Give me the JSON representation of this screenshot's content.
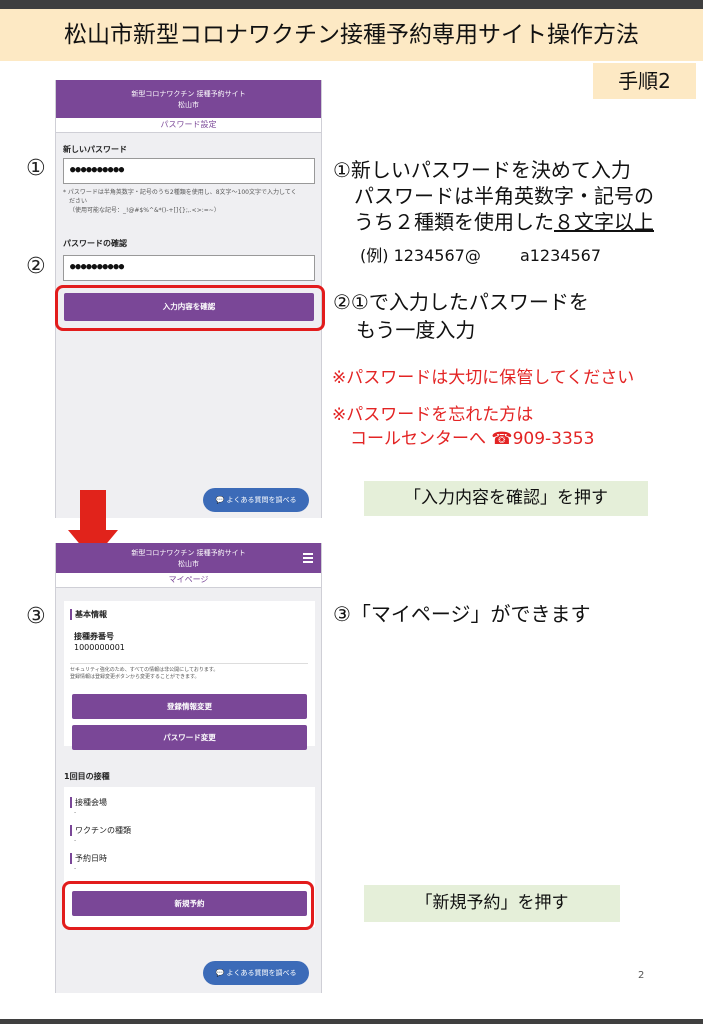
{
  "title": "松山市新型コロナワクチン接種予約専用サイト操作方法",
  "step_label": "手順2",
  "circled": [
    "①",
    "②",
    "③"
  ],
  "phone1": {
    "header_title": "新型コロナワクチン 接種予約サイト",
    "header_city": "松山市",
    "tab": "パスワード設定",
    "new_password_label": "新しいパスワード",
    "new_password_value": "●●●●●●●●●●",
    "note_line1": "* パスワードは半角英数字・記号のうち2種類を使用し、8文字～100文字で入力してく",
    "note_line2": "ださい",
    "note_line3": "（使用可能な記号：_!@#$%^&*()-+[]{};,.<>:=~）",
    "confirm_label": "パスワードの確認",
    "confirm_value": "●●●●●●●●●●",
    "confirm_button": "入力内容を確認",
    "faq": "よくある質問を調べる"
  },
  "phone2": {
    "header_title": "新型コロナワクチン 接種予約サイト",
    "header_city": "松山市",
    "tab": "マイページ",
    "basic_info": "基本情報",
    "ticket_label": "接種券番号",
    "ticket_number": "1000000001",
    "security_note1": "セキュリティ強化のため、すべての情報は非公開にしております。",
    "security_note2": "登録情報は登録変更ボタンから変更することができます。",
    "edit_button": "登録情報変更",
    "password_button": "パスワード変更",
    "first_dose": "1回目の接種",
    "venue_label": "接種会場",
    "vaccine_label": "ワクチンの種類",
    "datetime_label": "予約日時",
    "dash": "-",
    "new_booking_button": "新規予約",
    "faq": "よくある質問を調べる"
  },
  "instructions": {
    "s1_line1": "①新しいパスワードを決めて入力",
    "s1_line2": "パスワードは半角英数字・記号の",
    "s1_line3a": "うち２種類を使用した",
    "s1_line3b": "８文字以上",
    "s1_example_label": "(例) 1234567@",
    "s1_example_2": "a1234567",
    "s2_line1": "②①で入力したパスワードを",
    "s2_line2": "もう一度入力",
    "warn1": "※パスワードは大切に保管してください",
    "warn2_line1": "※パスワードを忘れた方は",
    "warn2_line2": "コールセンターへ ☎909-3353",
    "press_confirm": "「入力内容を確認」を押す",
    "s3": "③「マイページ」ができます",
    "press_new": "「新規予約」を押す"
  },
  "page_number": "2",
  "colors": {
    "accent": "#7a4797",
    "highlight": "#e21c1c",
    "title_bg": "#fde9c4",
    "note_bg": "#e5efd9"
  }
}
